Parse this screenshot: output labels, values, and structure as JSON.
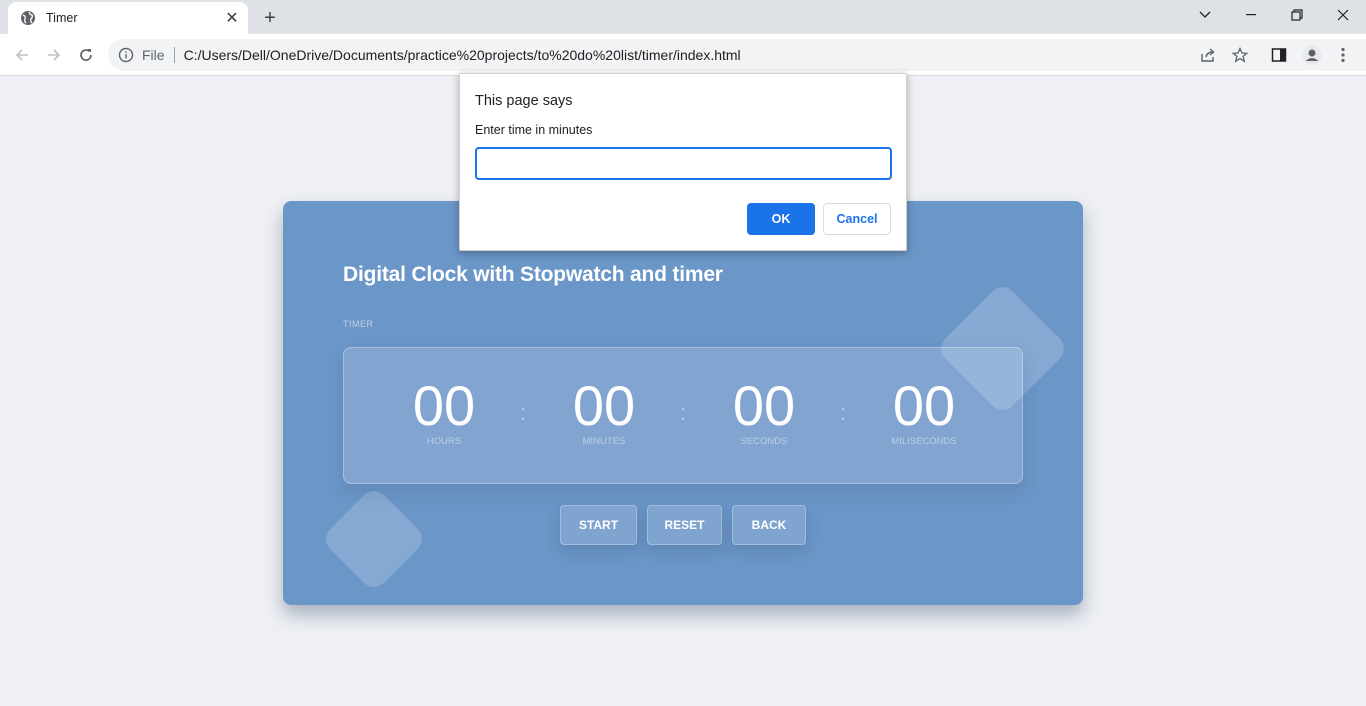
{
  "browser": {
    "tab_title": "Timer",
    "tab_close": "✕",
    "new_tab": "+",
    "file_label": "File",
    "url": "C:/Users/Dell/OneDrive/Documents/practice%20projects/to%20do%20list/timer/index.html",
    "window_controls": [
      "chevron-down-icon",
      "minimize-icon",
      "restore-icon",
      "close-icon"
    ]
  },
  "page": {
    "title": "Digital Clock with Stopwatch and timer",
    "section_label": "TIMER",
    "units": [
      {
        "value": "00",
        "label": "HOURS"
      },
      {
        "value": "00",
        "label": "MINUTES"
      },
      {
        "value": "00",
        "label": "SECONDS"
      },
      {
        "value": "00",
        "label": "MILISECONDS"
      }
    ],
    "colon": ":",
    "buttons": {
      "start": "START",
      "reset": "RESET",
      "back": "BACK"
    }
  },
  "dialog": {
    "title": "This page says",
    "message": "Enter time in minutes",
    "input_value": "",
    "ok": "OK",
    "cancel": "Cancel"
  },
  "colors": {
    "card": "#6b96c8",
    "page_bg": "#eef0f5",
    "accent": "#1a73e8"
  }
}
